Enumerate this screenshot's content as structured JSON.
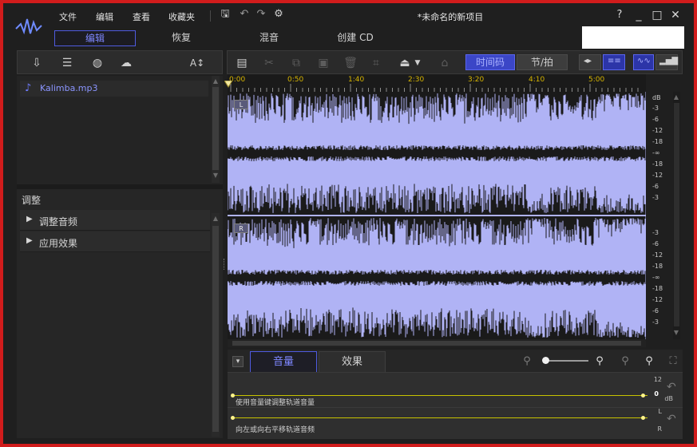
{
  "menu": [
    "文件",
    "编辑",
    "查看",
    "收藏夹"
  ],
  "window_title": "*未命名的新项目",
  "window_controls": {
    "help": "?",
    "minimize": "_",
    "maximize": "□",
    "close": "✕"
  },
  "mode_tabs": [
    "编辑",
    "恢复",
    "混音",
    "创建 CD"
  ],
  "left_toolbar": {
    "text_size": "A↕"
  },
  "file_list": [
    {
      "name": "Kalimba.mp3"
    }
  ],
  "adjust": {
    "title": "调整",
    "items": [
      "调整音频",
      "应用效果"
    ]
  },
  "editor_toolbar": {
    "timecode": "时间码",
    "beat": "节/拍"
  },
  "timeline": {
    "ticks": [
      "0:00",
      "0:50",
      "1:40",
      "2:30",
      "3:20",
      "4:10",
      "5:00"
    ]
  },
  "channels": {
    "left": "L",
    "right": "R"
  },
  "db_scale": {
    "unit": "dB",
    "left": [
      "-3",
      "-6",
      "-12",
      "-18",
      "-∞",
      "-18",
      "-12",
      "-6",
      "-3"
    ],
    "right": [
      "-3",
      "-6",
      "-12",
      "-18",
      "-∞",
      "-18",
      "-12",
      "-6",
      "-3"
    ]
  },
  "bottom_tabs": [
    "音量",
    "效果"
  ],
  "lanes": [
    {
      "caption": "使用音量键调整轨道音量",
      "scale_top": "12",
      "scale_mid": "0",
      "scale_unit": "dB"
    },
    {
      "caption": "向左或向右平移轨道音频",
      "scale_top": "L",
      "scale_bottom": "R"
    }
  ],
  "colors": {
    "accent": "#4f5be0",
    "waveform_bg": "#b0b3f5",
    "waveform": "#1a1a1a",
    "envelope": "#c7c300",
    "border": "#d11c1c"
  }
}
